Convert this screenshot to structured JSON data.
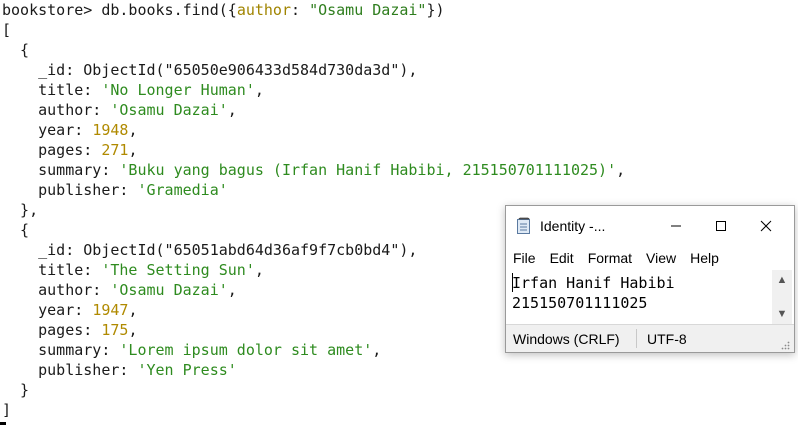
{
  "terminal": {
    "prompt": "bookstore> ",
    "command_prefix": "db.books.find({",
    "command_key": "author",
    "command_colon": ": ",
    "command_value": "\"Osamu Dazai\"",
    "command_suffix": "})",
    "open_bracket": "[",
    "close_bracket": "]",
    "documents": [
      {
        "open": "  {",
        "id_line": "    _id: ObjectId(\"65050e906433d584d730da3d\"),",
        "title_key": "    title: ",
        "title_val": "'No Longer Human'",
        "author_key": "    author: ",
        "author_val": "'Osamu Dazai'",
        "year_key": "    year: ",
        "year_val": "1948",
        "pages_key": "    pages: ",
        "pages_val": "271",
        "summary_key": "    summary: ",
        "summary_val": "'Buku yang bagus (Irfan Hanif Habibi, 215150701111025)'",
        "publisher_key": "    publisher: ",
        "publisher_val": "'Gramedia'",
        "close": "  },"
      },
      {
        "open": "  {",
        "id_line": "    _id: ObjectId(\"65051abd64d36af9f7cb0bd4\"),",
        "title_key": "    title: ",
        "title_val": "'The Setting Sun'",
        "author_key": "    author: ",
        "author_val": "'Osamu Dazai'",
        "year_key": "    year: ",
        "year_val": "1947",
        "pages_key": "    pages: ",
        "pages_val": "175",
        "summary_key": "    summary: ",
        "summary_val": "'Lorem ipsum dolor sit amet'",
        "publisher_key": "    publisher: ",
        "publisher_val": "'Yen Press'",
        "close": "  }"
      }
    ]
  },
  "notepad": {
    "title": "Identity -...",
    "menu": [
      "File",
      "Edit",
      "Format",
      "View",
      "Help"
    ],
    "content_lines": [
      "Irfan Hanif Habibi",
      "215150701111025"
    ],
    "status_eol": "Windows (CRLF)",
    "status_encoding": "UTF-8"
  },
  "colors": {
    "string": "#2e8b1f",
    "number": "#b08a00",
    "key_highlight": "#a08400"
  }
}
